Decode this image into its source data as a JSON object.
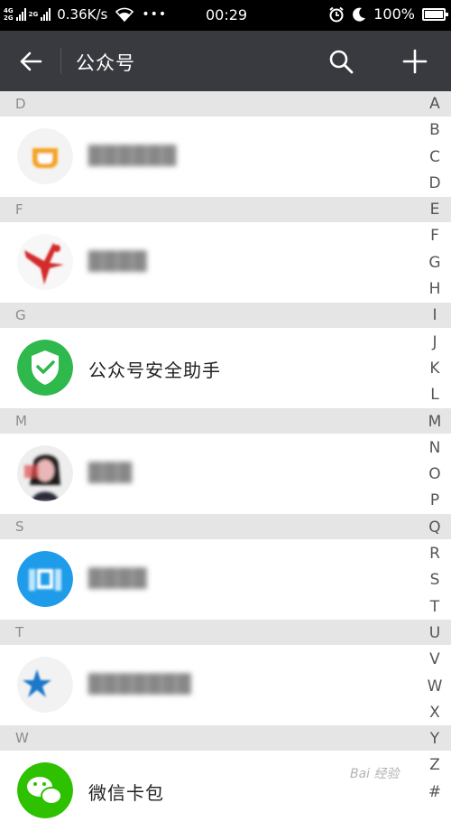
{
  "status_bar": {
    "network_top": "4G",
    "network_bottom": "2G",
    "network2_top": "2G",
    "speed": "0.36K/s",
    "dots": "•••",
    "time": "00:29",
    "battery": "100%"
  },
  "header": {
    "title": "公众号"
  },
  "sections": [
    {
      "letter": "D",
      "item": {
        "name": "██████",
        "avatar": "orange-cup",
        "blurred": true
      }
    },
    {
      "letter": "F",
      "item": {
        "name": "████",
        "avatar": "red-figure",
        "blurred": true
      }
    },
    {
      "letter": "G",
      "item": {
        "name": "公众号安全助手",
        "avatar": "green-shield",
        "blurred": false
      }
    },
    {
      "letter": "M",
      "item": {
        "name": "███",
        "avatar": "person-photo",
        "blurred": true
      }
    },
    {
      "letter": "S",
      "item": {
        "name": "████",
        "avatar": "blue-logo",
        "blurred": true
      }
    },
    {
      "letter": "T",
      "item": {
        "name": "███████",
        "avatar": "star-moon",
        "blurred": true
      }
    },
    {
      "letter": "W",
      "item": {
        "name": "微信卡包",
        "avatar": "wechat-green",
        "blurred": false
      }
    }
  ],
  "index_letters": [
    "A",
    "B",
    "C",
    "D",
    "E",
    "F",
    "G",
    "H",
    "I",
    "J",
    "K",
    "L",
    "M",
    "N",
    "O",
    "P",
    "Q",
    "R",
    "S",
    "T",
    "U",
    "V",
    "W",
    "X",
    "Y",
    "Z",
    "#"
  ],
  "watermark": "Bai 经验",
  "colors": {
    "title_bar": "#393a3f",
    "section_bg": "#e5e5e5",
    "wechat_green": "#2dc100"
  }
}
